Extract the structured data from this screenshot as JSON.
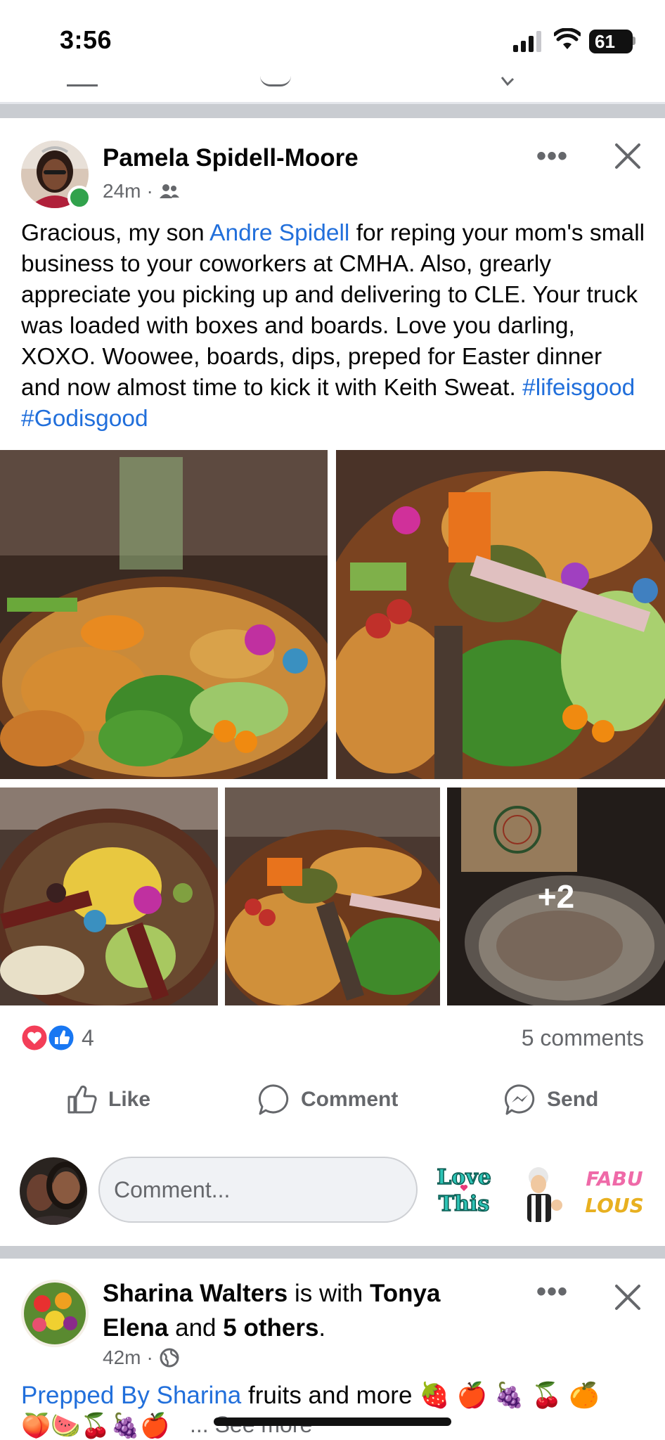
{
  "status_bar": {
    "time": "3:56",
    "battery": "61",
    "icons": [
      "signal-icon",
      "wifi-icon",
      "battery-icon"
    ]
  },
  "post": {
    "author": "Pamela Spidell-Moore",
    "time": "24m",
    "audience_icon": "friends-icon",
    "more_label": "•••",
    "text_parts": {
      "p1": "Gracious, my son ",
      "mention": "Andre Spidell",
      "p2": " for reping your mom's small business to your coworkers at CMHA. Also, grearly appreciate you picking up and delivering to CLE. Your truck was loaded with boxes and boards. Love you darling, XOXO. Woowee, boards, dips, preped for Easter dinner and now almost time to kick it with Keith Sweat. ",
      "hashtag1": "#lifeisgood",
      "hashtag2": "#Godisgood"
    },
    "extra_photos": "+2",
    "reaction_count": "4",
    "comments": "5 comments",
    "actions": {
      "like": "Like",
      "comment": "Comment",
      "send": "Send"
    },
    "comment_placeholder": "Comment...",
    "stickers": {
      "love": "Love This",
      "fab": "FABU LOUS"
    }
  },
  "next_post": {
    "author": "Sharina Walters",
    "with": "is with",
    "tagged": "Tonya Elena",
    "and": "and",
    "others": "5 others",
    "time": "42m",
    "audience_icon": "globe-icon",
    "page_link": "Prepped By Sharina",
    "text": " fruits and more 🍓 🍎 🍇 🍒 🍊",
    "see_more": "... See more"
  },
  "colors": {
    "link": "#216fdb",
    "secondary": "#65676b",
    "online": "#31a24c",
    "like_blue": "#1877f2",
    "love_red": "#f33e58"
  }
}
